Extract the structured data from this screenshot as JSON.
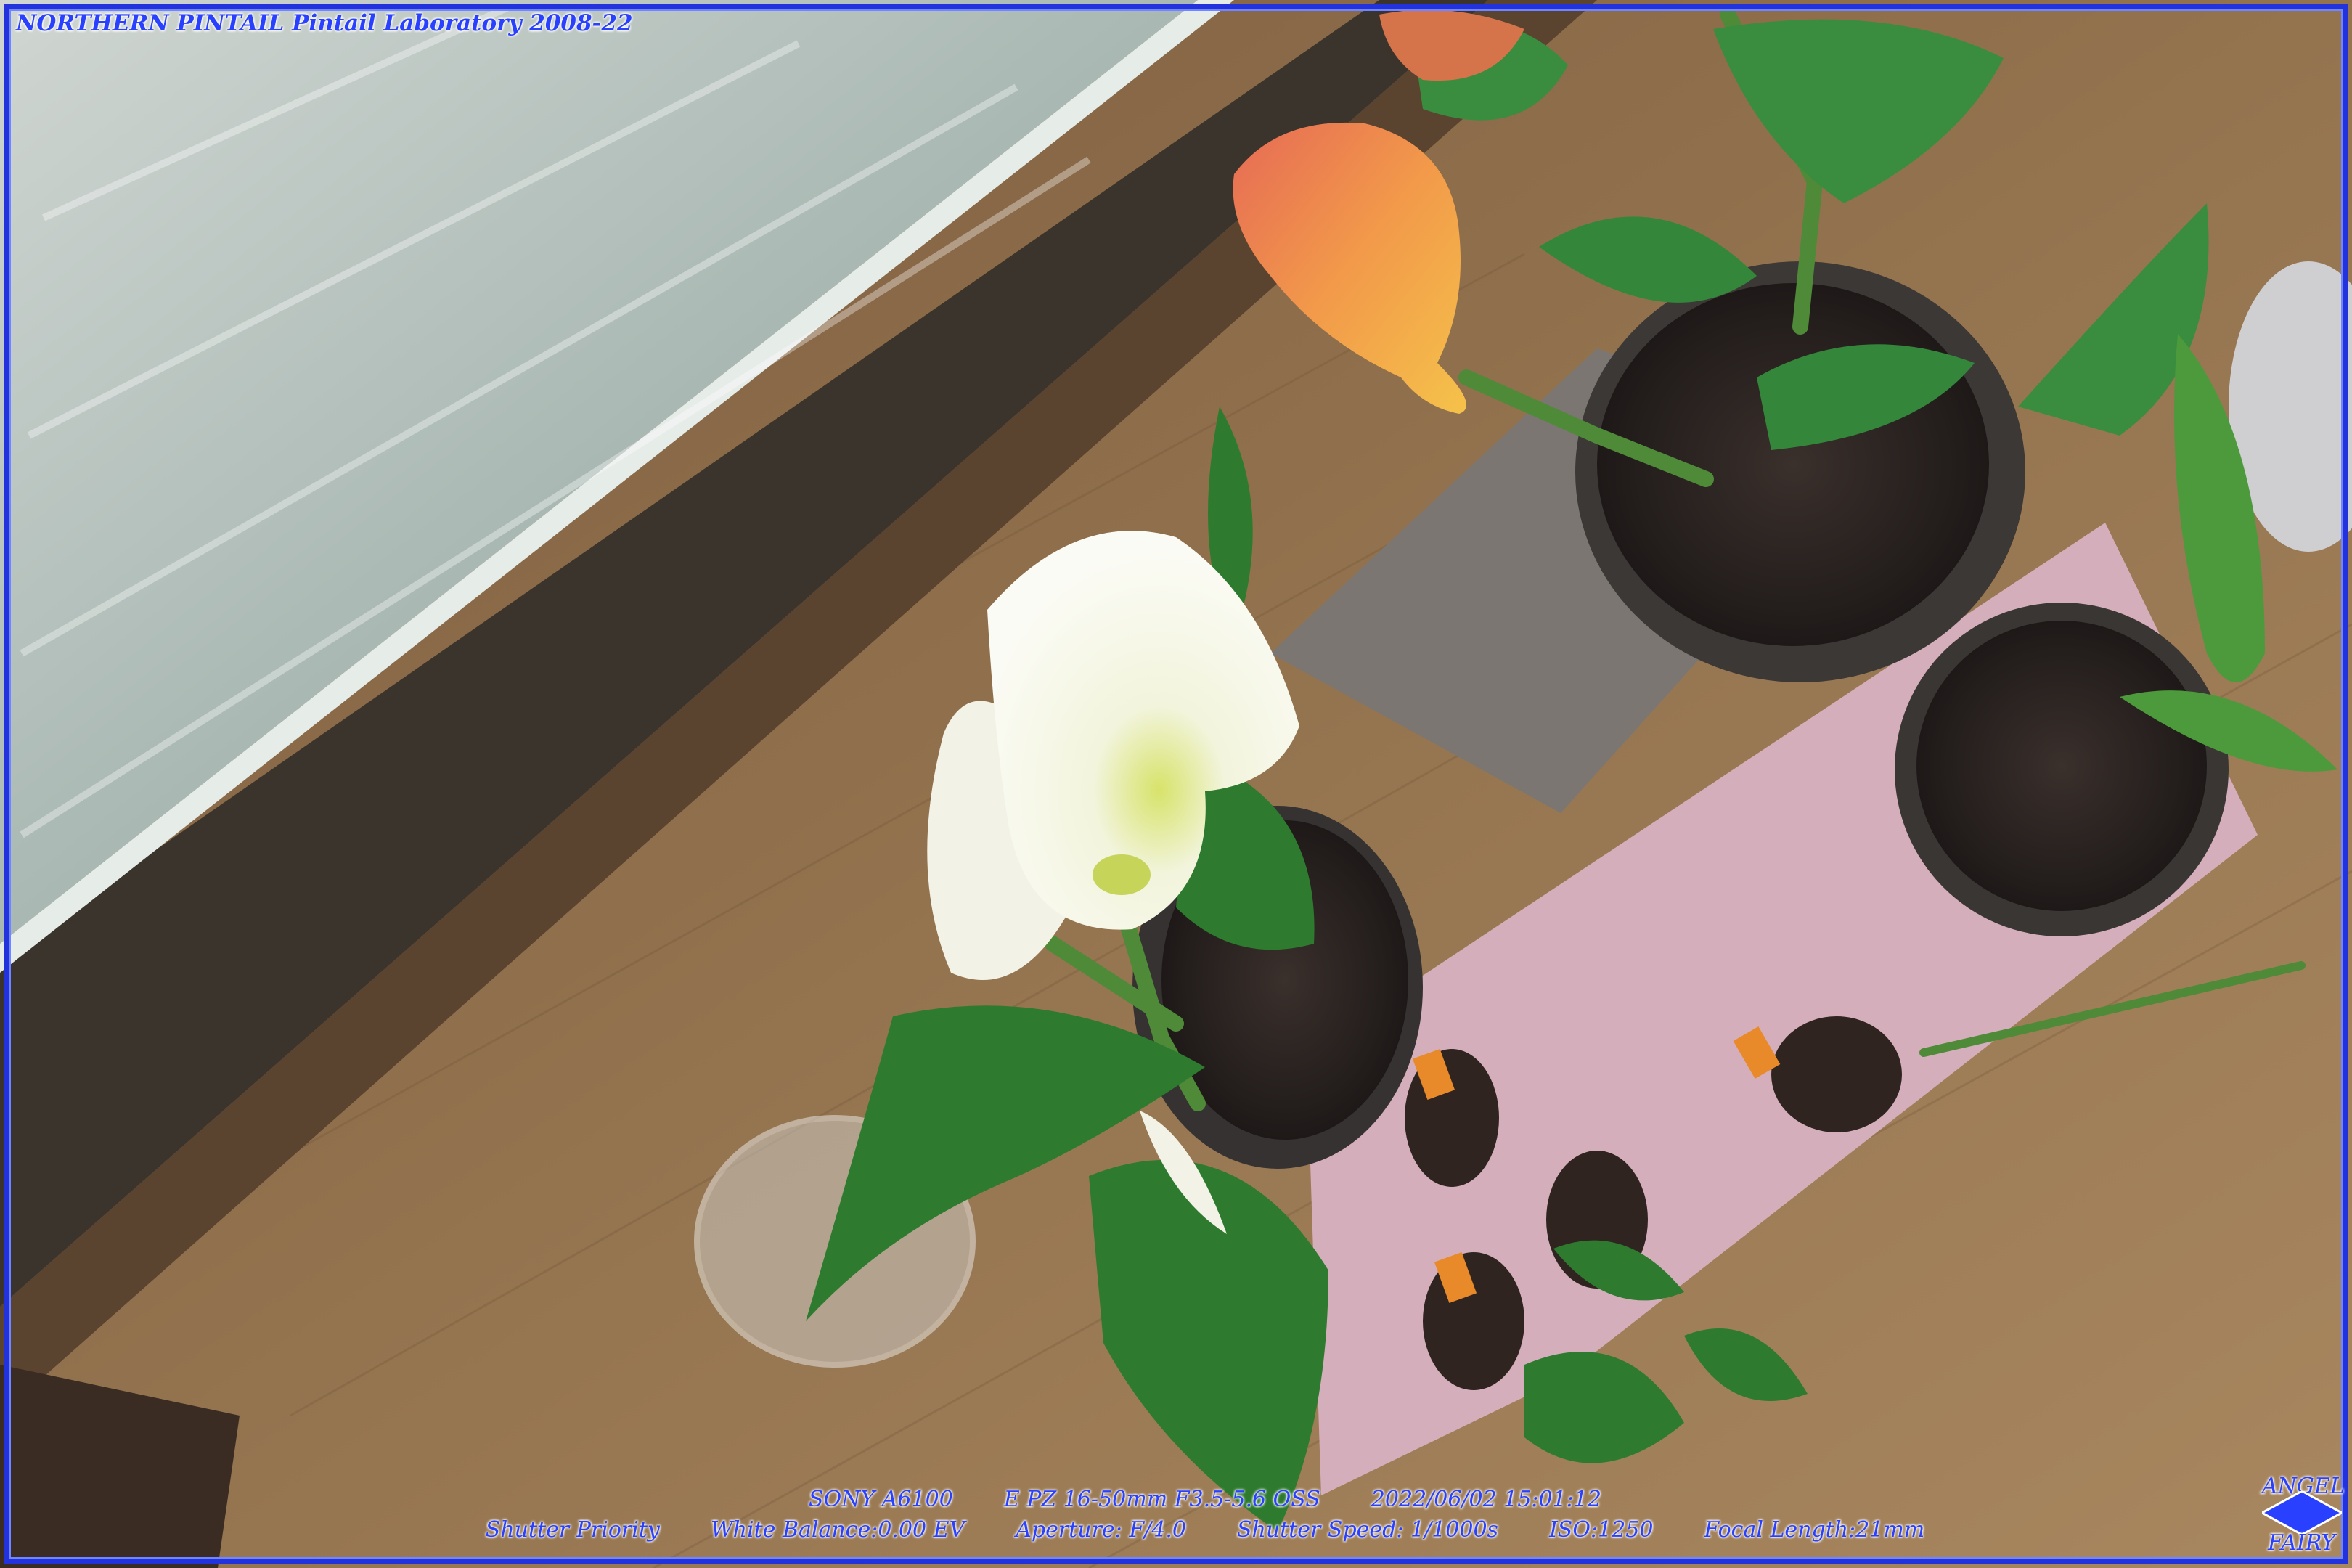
{
  "header": {
    "brand": "NORTHERN PINTAIL",
    "lab": "Pintail Laboratory 2008-22"
  },
  "exif": {
    "camera": "SONY A6100",
    "lens": "E PZ 16-50mm F3.5-5.6 OSS",
    "datetime": "2022/06/02 15:01:12",
    "mode": "Shutter Priority",
    "white_balance": "White Balance:0.00 EV",
    "aperture": "Aperture: F/4.0",
    "shutter_speed": "Shutter Speed: 1/1000s",
    "iso": "ISO:1250",
    "focal_length": "Focal Length:21mm"
  },
  "logo": {
    "top": "ANGEL",
    "bottom": "FAIRY"
  },
  "colors": {
    "overlay_text": "#2a40ff",
    "border": "#2233dd",
    "wood_floor": "#8a6a47",
    "window_glass": "#b9c6c4",
    "white_calla": "#f7f6ee",
    "orange_calla": "#f0a040",
    "leaf": "#2f7a30",
    "mat": "#d9b3c3"
  }
}
